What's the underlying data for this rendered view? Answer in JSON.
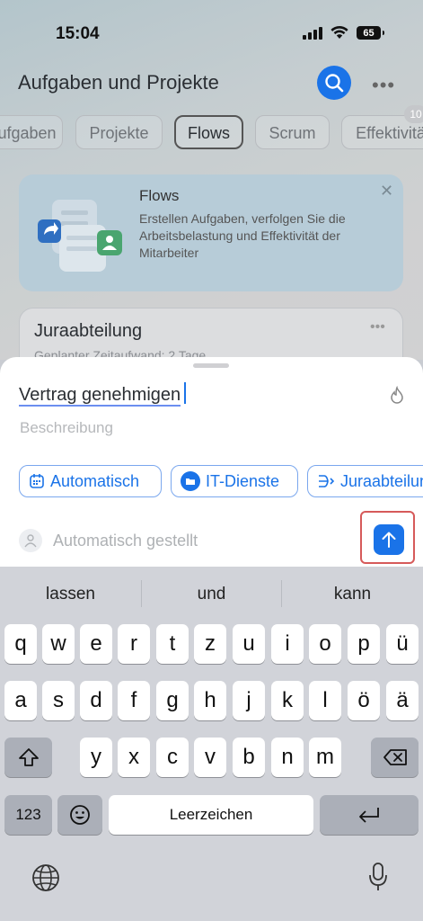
{
  "status": {
    "time": "15:04",
    "battery": "65"
  },
  "header": {
    "title": "Aufgaben und Projekte"
  },
  "tabs": [
    "ufgaben",
    "Projekte",
    "Flows",
    "Scrum",
    "Effektivitä"
  ],
  "tabs_active_index": 2,
  "tab_badge": "10",
  "flows_card": {
    "title": "Flows",
    "description": "Erstellen Aufgaben, verfolgen Sie die Arbeitsbelastung und Effektivität der Mitarbeiter"
  },
  "project_card": {
    "name": "Juraabteilung",
    "subtitle": "Geplanter Zeitaufwand: 2 Tage"
  },
  "sheet": {
    "task_title": "Vertrag genehmigen",
    "description_placeholder": "Beschreibung",
    "chips": [
      "Automatisch",
      "IT-Dienste",
      "Juraabteilung"
    ],
    "assignee": "Automatisch gestellt"
  },
  "keyboard": {
    "suggestions": [
      "lassen",
      "und",
      "kann"
    ],
    "row1": [
      "q",
      "w",
      "e",
      "r",
      "t",
      "z",
      "u",
      "i",
      "o",
      "p",
      "ü"
    ],
    "row2": [
      "a",
      "s",
      "d",
      "f",
      "g",
      "h",
      "j",
      "k",
      "l",
      "ö",
      "ä"
    ],
    "row3": [
      "y",
      "x",
      "c",
      "v",
      "b",
      "n",
      "m"
    ],
    "numbers_key": "123",
    "space_key": "Leerzeichen"
  },
  "colors": {
    "accent": "#1a73e8",
    "highlight_border": "#d65a5a"
  }
}
